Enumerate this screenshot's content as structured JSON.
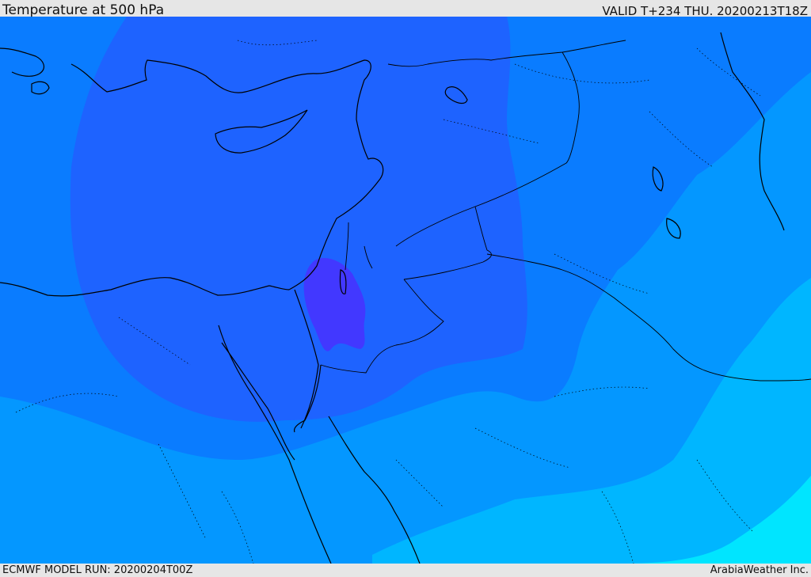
{
  "header": {
    "title": "Temperature at 500 hPa",
    "valid": "VALID T+234 THU. 20200213T18Z"
  },
  "footer": {
    "model_run": "ECMWF MODEL RUN: 20200204T00Z",
    "credit": "ArabiaWeather Inc."
  },
  "map": {
    "field": "Temperature at 500 hPa",
    "colors": {
      "band1": "#00E5FF",
      "band2": "#00B6FF",
      "band3": "#0497FF",
      "band4": "#0A7CFF",
      "band5": "#1E63FF",
      "band6": "#4238FF",
      "coastline": "#000000",
      "border": "#000000"
    }
  }
}
